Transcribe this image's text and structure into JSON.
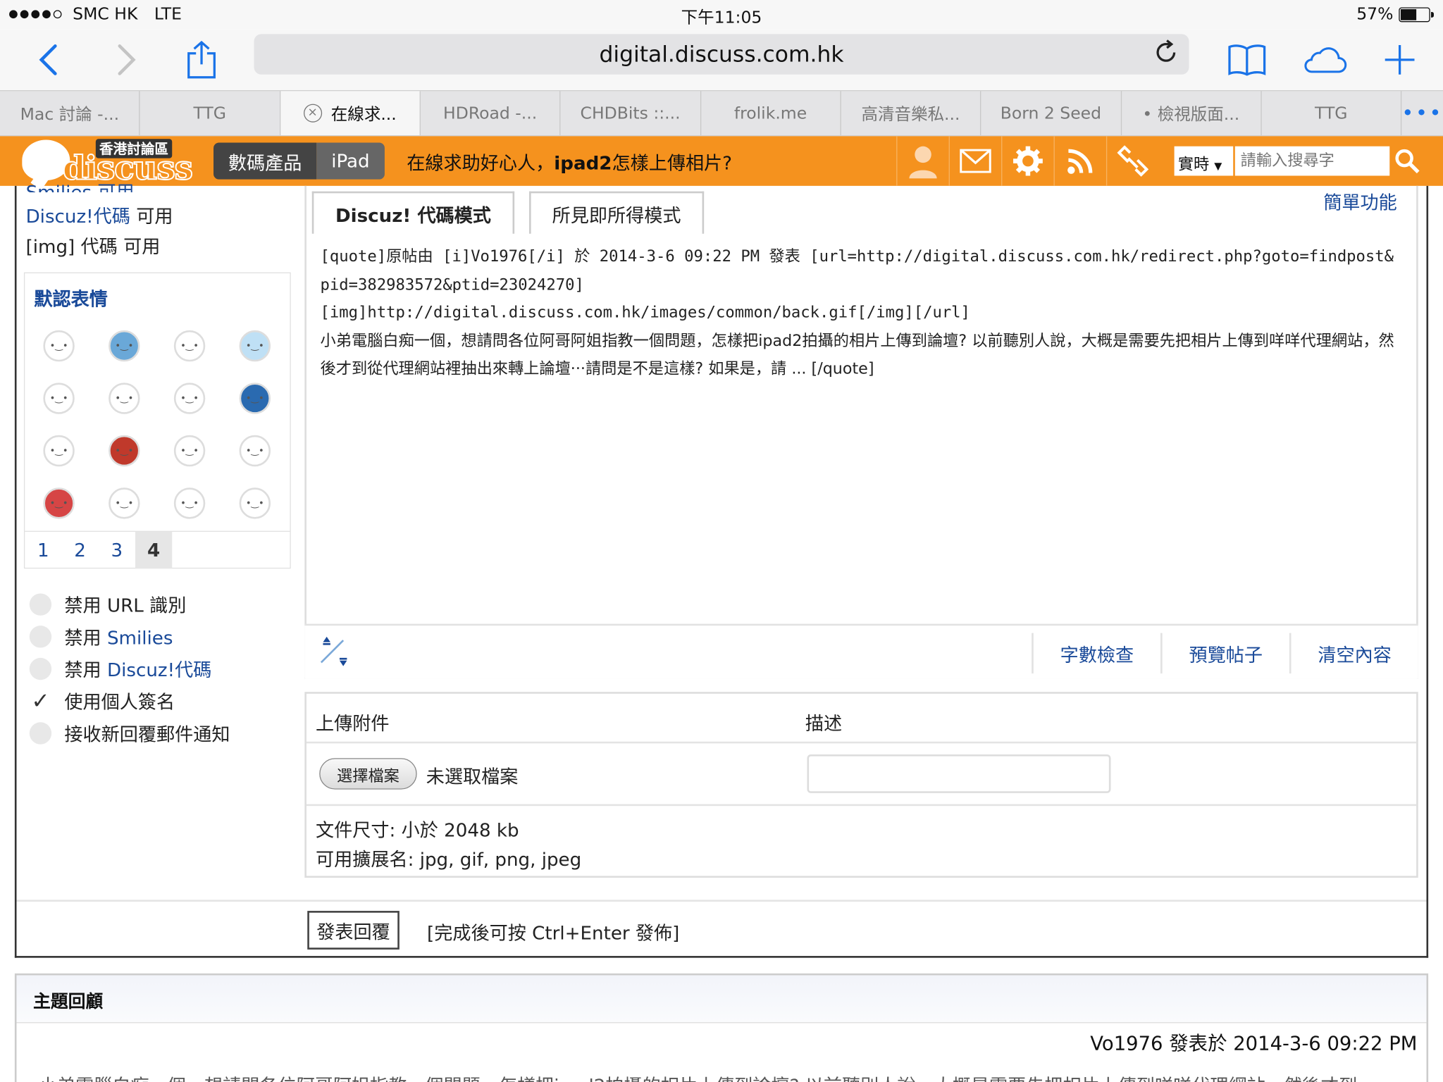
{
  "status": {
    "carrier": "SMC HK",
    "network": "LTE",
    "time": "下午11:05",
    "battery": "57%",
    "battery_level": 0.57
  },
  "browser": {
    "url": "digital.discuss.com.hk",
    "tabs": [
      "Mac 討論 -...",
      "TTG",
      "在線求...",
      "HDRoad -...",
      "CHDBits ::...",
      "frolik.me",
      "高清音樂私...",
      "Born 2 Seed",
      "• 檢視版面...",
      "TTG"
    ],
    "active_tab": 2,
    "more": "•••"
  },
  "header": {
    "logo_top": "香港討論區",
    "logo_word": "discuss",
    "crumb1": "數碼產品",
    "crumb2": "iPad",
    "title_pre": "在線求助好心人，",
    "title_bold": "ipad2",
    "title_post": "怎樣上傳相片?",
    "search_scope": "實時",
    "search_placeholder": "請輸入搜尋字"
  },
  "sidebar": {
    "cut_line": "Smilies 可用",
    "line1_link": "Discuz!代碼",
    "line1_rest": " 可用",
    "line2": "[img] 代碼 可用",
    "emoji_title": "默認表情",
    "emojis": [
      "smile-face",
      "blue-blob-face",
      "shy-face",
      "crying-face",
      "shout-face",
      "angry-face",
      "sweat-face",
      "blue-ball-face",
      "wink-face",
      "red-heart",
      "grin-face",
      "scream-face",
      "red-hat-face",
      "drool-face",
      "dizzy-text-face",
      "big-eyes-face"
    ],
    "pages": [
      "1",
      "2",
      "3",
      "4"
    ],
    "current_page": "4",
    "options": [
      {
        "pre": "禁用 URL 識別",
        "link": "",
        "checked": false
      },
      {
        "pre": "禁用 ",
        "link": "Smilies",
        "checked": false
      },
      {
        "pre": "禁用 ",
        "link": "Discuz!代碼",
        "checked": false
      },
      {
        "pre": "使用個人簽名",
        "link": "",
        "checked": true
      },
      {
        "pre": "接收新回覆郵件通知",
        "link": "",
        "checked": false
      }
    ]
  },
  "editor": {
    "mode_code": "Discuz! 代碼模式",
    "mode_wysiwyg": "所見即所得模式",
    "simple_link": "簡單功能",
    "content_line1": "[quote]原帖由 [i]Vo1976[/i] 於 2014-3-6 09:22 PM 發表 [url=http://digital.discuss.com.hk/redirect.php?goto=findpost&pid=382983572&ptid=23024270]",
    "content_line2": "[img]http://digital.discuss.com.hk/images/common/back.gif[/img][/url]",
    "content_line3": "小弟電腦白痴一個，想請問各位阿哥阿姐指教一個問題，怎樣把ipad2拍攝的相片上傳到論壇? 以前聽別人說，大概是需要先把相片上傳到咩咩代理網站，然後才到從代理網站裡抽出來轉上論壇···請問是不是這樣? 如果是，請 ... [/quote]",
    "btn_count": "字數檢查",
    "btn_preview": "預覽帖子",
    "btn_clear": "清空內容"
  },
  "attach": {
    "col1": "上傳附件",
    "col2": "描述",
    "choose_btn": "選擇檔案",
    "no_file": "未選取檔案",
    "size_label": "文件尺寸: 小於 2048 kb",
    "ext_label": "可用擴展名: jpg, gif, png, jpeg"
  },
  "submit": {
    "button": "發表回覆",
    "hint": "[完成後可按 Ctrl+Enter 發佈]"
  },
  "review": {
    "title": "主題回顧",
    "meta": "Vo1976 發表於 2014-3-6 09:22 PM",
    "snippet": "小弟電腦白痴一個，想請問各位阿哥阿姐指教一個問題，怎樣把ipad2拍攝的相片上傳到論壇? 以前聽別人說，大概是需要先把相片上傳到咩咩代理網站，然後才到"
  }
}
